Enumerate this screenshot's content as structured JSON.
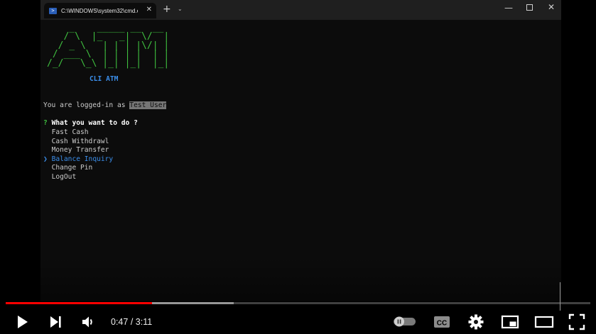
{
  "terminal": {
    "tab_title": "C:\\WINDOWS\\system32\\cmd.e",
    "tab_icon": "powershell-icon",
    "new_tab": "+",
    "dropdown": "⌄",
    "ascii_art": "    _    _____ __  __\n   / \\  |_   _|  \\/  |\n  / _ \\   | | | |\\/| |\n / ___ \\  | | | |  | |\n/_/   \\_\\ |_| |_|  |_|",
    "banner_subtitle": "CLI ATM",
    "login_prefix": "You are logged-in as ",
    "login_user": "Test User",
    "question_mark": "?",
    "question": "What you want to do ?",
    "pointer": "❯",
    "menu_items": [
      {
        "label": "Fast Cash",
        "selected": false
      },
      {
        "label": "Cash Withdrawl",
        "selected": false
      },
      {
        "label": "Money Transfer",
        "selected": false
      },
      {
        "label": "Balance Inquiry",
        "selected": true
      },
      {
        "label": "Change Pin",
        "selected": false
      },
      {
        "label": "LogOut",
        "selected": false
      }
    ],
    "colors": {
      "background": "#0c0c0c",
      "ascii_green": "#3fbf3f",
      "accent_blue": "#3b8eea",
      "text": "#cccccc"
    }
  },
  "player": {
    "current_time": "0:47",
    "duration": "3:11",
    "time_separator": " / ",
    "progress_fraction": 0.25,
    "buffer_fraction": 0.39,
    "icons": [
      "play-icon",
      "next-icon",
      "volume-icon",
      "autoplay-toggle-icon",
      "cc-icon",
      "gear-icon",
      "miniplayer-icon",
      "theater-icon",
      "fullscreen-icon"
    ],
    "progress_color": "#ff0000"
  }
}
